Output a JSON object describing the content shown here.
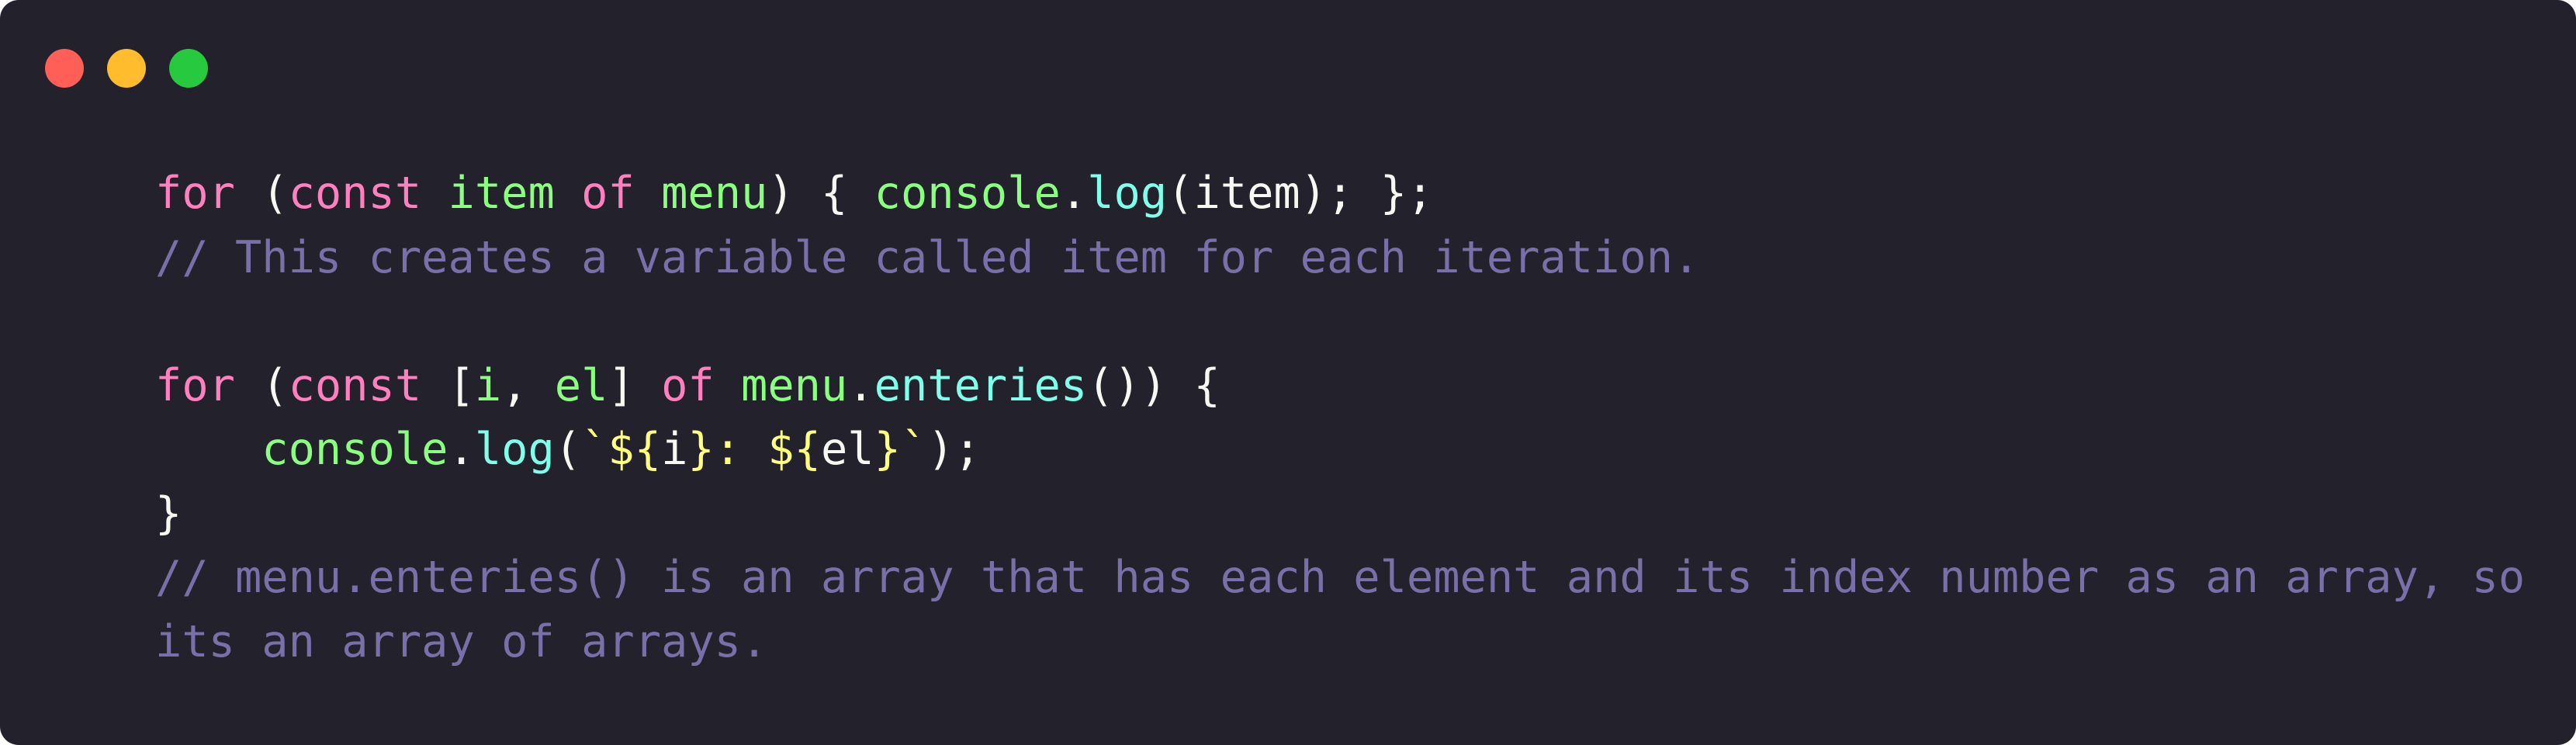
{
  "window": {
    "background": "#22212c",
    "controls": [
      {
        "name": "close",
        "color": "#ff5f56"
      },
      {
        "name": "minimize",
        "color": "#ffbd2e"
      },
      {
        "name": "maximize",
        "color": "#27c93f"
      }
    ]
  },
  "palette": {
    "keyword": "#ff80bf",
    "variable": "#8aff80",
    "function": "#80ffea",
    "plain": "#f8f8f2",
    "comment": "#7970a9",
    "template": "#ffff80"
  },
  "code_lines": [
    [
      {
        "text": "for",
        "type": "keyword"
      },
      {
        "text": " (",
        "type": "plain"
      },
      {
        "text": "const",
        "type": "keyword"
      },
      {
        "text": " ",
        "type": "plain"
      },
      {
        "text": "item",
        "type": "variable"
      },
      {
        "text": " ",
        "type": "plain"
      },
      {
        "text": "of",
        "type": "keyword"
      },
      {
        "text": " ",
        "type": "plain"
      },
      {
        "text": "menu",
        "type": "variable"
      },
      {
        "text": ") { ",
        "type": "plain"
      },
      {
        "text": "console",
        "type": "variable"
      },
      {
        "text": ".",
        "type": "plain"
      },
      {
        "text": "log",
        "type": "function"
      },
      {
        "text": "(item); };",
        "type": "plain"
      }
    ],
    [
      {
        "text": "// This creates a variable called item for each iteration.",
        "type": "comment"
      }
    ],
    [],
    [
      {
        "text": "for",
        "type": "keyword"
      },
      {
        "text": " (",
        "type": "plain"
      },
      {
        "text": "const",
        "type": "keyword"
      },
      {
        "text": " [",
        "type": "plain"
      },
      {
        "text": "i",
        "type": "variable"
      },
      {
        "text": ", ",
        "type": "plain"
      },
      {
        "text": "el",
        "type": "variable"
      },
      {
        "text": "] ",
        "type": "plain"
      },
      {
        "text": "of",
        "type": "keyword"
      },
      {
        "text": " ",
        "type": "plain"
      },
      {
        "text": "menu",
        "type": "variable"
      },
      {
        "text": ".",
        "type": "plain"
      },
      {
        "text": "enteries",
        "type": "function"
      },
      {
        "text": "()) {",
        "type": "plain"
      }
    ],
    [
      {
        "text": "    ",
        "type": "plain"
      },
      {
        "text": "console",
        "type": "variable"
      },
      {
        "text": ".",
        "type": "plain"
      },
      {
        "text": "log",
        "type": "function"
      },
      {
        "text": "(",
        "type": "plain"
      },
      {
        "text": "`${",
        "type": "template"
      },
      {
        "text": "i",
        "type": "plain"
      },
      {
        "text": "}: ${",
        "type": "template"
      },
      {
        "text": "el",
        "type": "plain"
      },
      {
        "text": "}`",
        "type": "template"
      },
      {
        "text": ");",
        "type": "plain"
      }
    ],
    [
      {
        "text": "}",
        "type": "plain"
      }
    ],
    [
      {
        "text": "// menu.enteries() is an array that has each element and its index number as an array, so",
        "type": "comment"
      }
    ],
    [
      {
        "text": "its an array of arrays.",
        "type": "comment"
      }
    ]
  ]
}
